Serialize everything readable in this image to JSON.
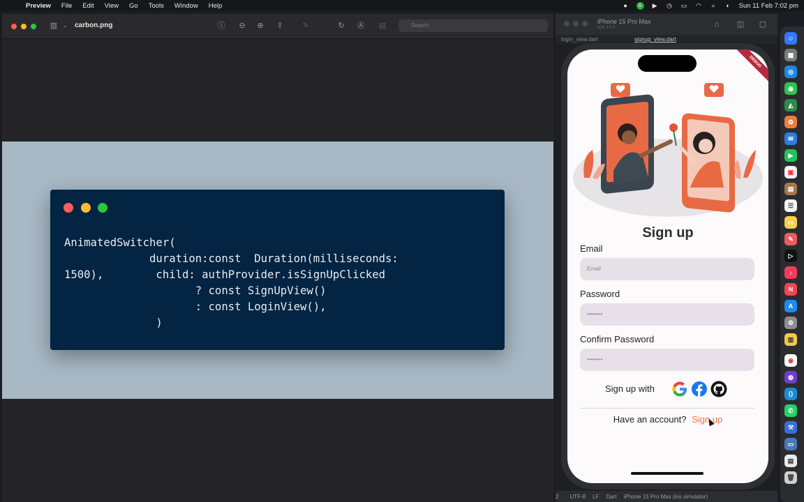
{
  "menubar": {
    "app": "Preview",
    "items": [
      "File",
      "Edit",
      "View",
      "Go",
      "Tools",
      "Window",
      "Help"
    ],
    "datetime": "Sun 11 Feb  7:02 pm"
  },
  "preview": {
    "title": "carbon.png",
    "search_placeholder": "Search",
    "code_lines": [
      "AnimatedSwitcher(",
      "             duration:const  Duration(milliseconds:",
      "1500),        child: authProvider.isSignUpClicked",
      "                    ? const SignUpView()",
      "                    : const LoginView(),",
      "              )"
    ]
  },
  "ide": {
    "device_title": "iPhone 15 Pro Max",
    "device_sub": "iOS 17.0",
    "tab1": "login_view.dart",
    "tab2": "signup_view.dart",
    "status": [
      "2",
      "UTF-8",
      "LF",
      "Dart",
      "iPhone 15 Pro Max (ios simulator)"
    ]
  },
  "app": {
    "debug_banner": "DEBUG",
    "heading": "Sign up",
    "email_label": "Email",
    "email_placeholder": "Email",
    "password_label": "Password",
    "password_value": "••••••••",
    "confirm_label": "Confirm Password",
    "confirm_value": "••••••••",
    "social_label": "Sign up with",
    "account_text": "Have an account?",
    "account_link": "Sign up"
  },
  "colors": {
    "code_bg": "#032442",
    "accent": "#e8734a",
    "field_bg": "#e7e0e8"
  }
}
